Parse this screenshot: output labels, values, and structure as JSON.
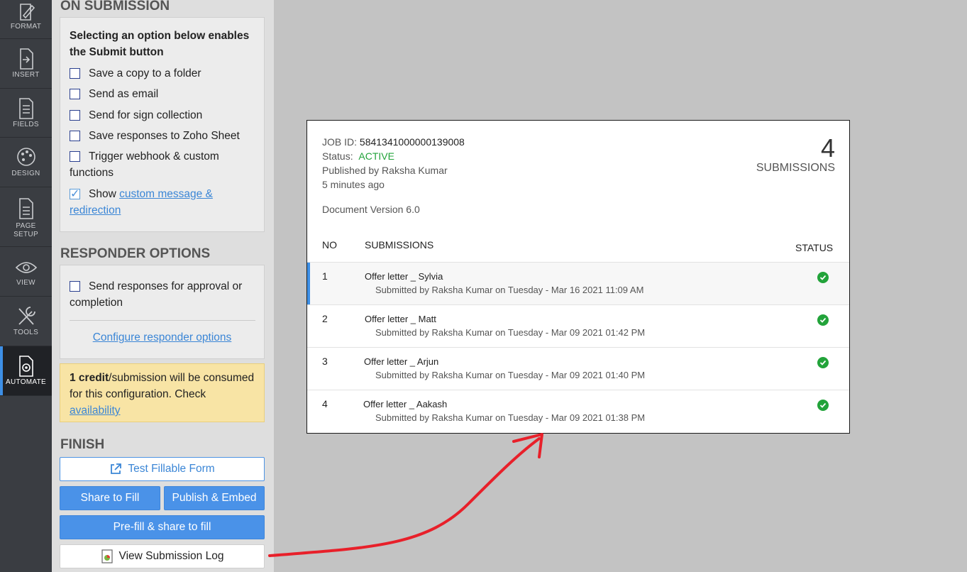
{
  "rail": [
    {
      "label": "FORMAT",
      "icon": "format-icon"
    },
    {
      "label": "INSERT",
      "icon": "insert-icon"
    },
    {
      "label": "FIELDS",
      "icon": "fields-icon"
    },
    {
      "label": "DESIGN",
      "icon": "design-icon"
    },
    {
      "label": "PAGE",
      "label2": "SETUP",
      "icon": "page-setup-icon"
    },
    {
      "label": "VIEW",
      "icon": "view-icon"
    },
    {
      "label": "TOOLS",
      "icon": "tools-icon"
    },
    {
      "label": "AUTOMATE",
      "icon": "automate-icon",
      "active": true
    }
  ],
  "on_submission": {
    "title": "ON SUBMISSION",
    "heading": "Selecting an option below enables the Submit button",
    "options": [
      {
        "label": "Save a copy to a folder",
        "checked": false
      },
      {
        "label": "Send as email",
        "checked": false
      },
      {
        "label": "Send for sign collection",
        "checked": false
      },
      {
        "label": "Save responses to Zoho Sheet",
        "checked": false
      },
      {
        "label": "Trigger webhook & custom functions",
        "checked": false
      }
    ],
    "show_option": {
      "prefix": "Show ",
      "link": "custom message & redirection",
      "checked": true
    }
  },
  "responder": {
    "title": "RESPONDER OPTIONS",
    "option": "Send responses for approval or completion",
    "configure_link": "Configure responder options"
  },
  "notice": {
    "bold": "1 credit",
    "text": "/submission will be consumed for this configuration. Check ",
    "link": "availability"
  },
  "finish": {
    "title": "FINISH",
    "test_button": "Test Fillable Form",
    "share_button": "Share to Fill",
    "publish_button": "Publish & Embed",
    "prefill_button": "Pre-fill & share to fill",
    "log_button": "View Submission Log"
  },
  "log": {
    "job_id_label": "JOB ID:",
    "job_id": "5841341000000139008",
    "status_label": "Status:",
    "status": "ACTIVE",
    "published_by": "Published by Raksha Kumar",
    "published_when": "5 minutes ago",
    "version_label": "Document Version",
    "version": "6.0",
    "count": "4",
    "count_label": "SUBMISSIONS",
    "columns": {
      "no": "NO",
      "submissions": "SUBMISSIONS",
      "status": "STATUS"
    },
    "rows": [
      {
        "no": "1",
        "name": "Offer letter _ Sylvia",
        "sub": "Submitted by Raksha Kumar on Tuesday - Mar 16 2021 11:09 AM"
      },
      {
        "no": "2",
        "name": "Offer letter _ Matt",
        "sub": "Submitted by Raksha Kumar on Tuesday - Mar 09 2021 01:42 PM"
      },
      {
        "no": "3",
        "name": "Offer letter _ Arjun",
        "sub": "Submitted by Raksha Kumar on Tuesday - Mar 09 2021 01:40 PM"
      },
      {
        "no": "4",
        "name": "Offer letter _ Aakash",
        "sub": "Submitted by Raksha Kumar on Tuesday - Mar 09 2021 01:38 PM"
      }
    ]
  },
  "colors": {
    "accent": "#4a92e8",
    "success": "#22a33a",
    "arrow": "#e8202a"
  }
}
